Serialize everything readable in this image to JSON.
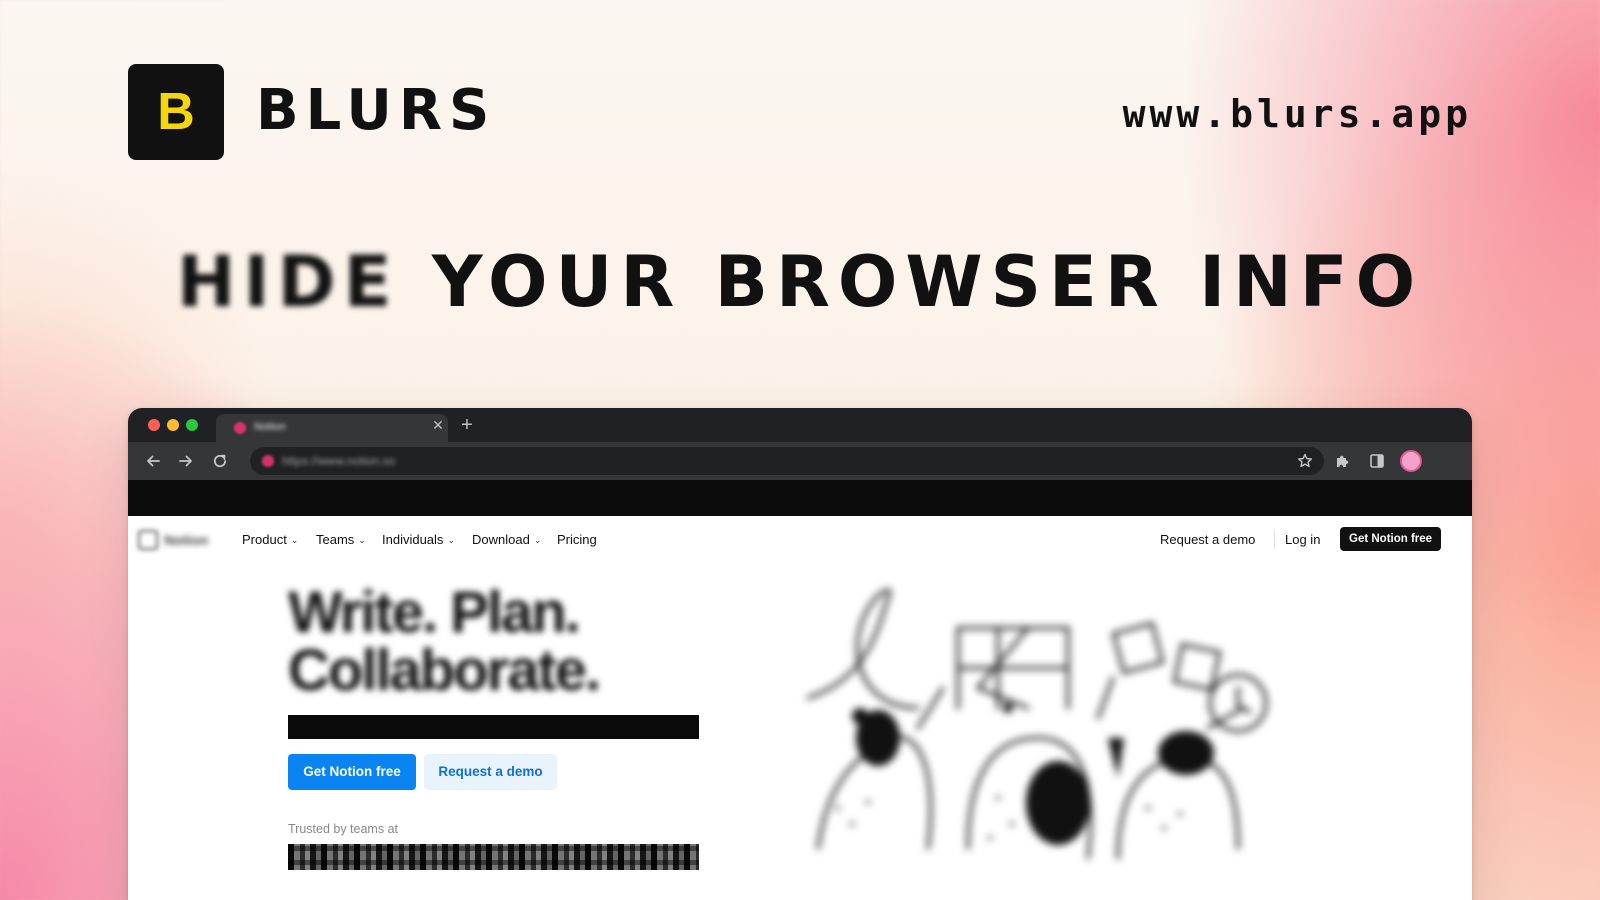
{
  "brand": {
    "logo_letter": "B",
    "name": "BLURS",
    "url": "www.blurs.app",
    "logo_bg": "#111111",
    "logo_fg": "#f5d60c"
  },
  "headline": {
    "blurred_word": "HIDE",
    "rest": " YOUR BROWSER INFO"
  },
  "browser": {
    "tab_title": "Notion",
    "address_url": "https://www.notion.so",
    "icons": [
      "back-icon",
      "forward-icon",
      "reload-icon",
      "star-icon",
      "extensions-icon",
      "side-panel-icon",
      "profile-avatar"
    ]
  },
  "notion": {
    "logo_text": "Notion",
    "nav": {
      "items": [
        "Product",
        "Teams",
        "Individuals",
        "Download",
        "Pricing"
      ],
      "request_demo": "Request a demo",
      "login": "Log in",
      "cta": "Get Notion free"
    },
    "hero": {
      "title_line1": "Write. Plan.",
      "title_line2": "Collaborate.",
      "primary_button": "Get Notion free",
      "secondary_button": "Request a demo",
      "trusted": "Trusted by teams at"
    },
    "colors": {
      "primary": "#0b84f3",
      "secondary_bg": "#e8f3fe"
    }
  }
}
